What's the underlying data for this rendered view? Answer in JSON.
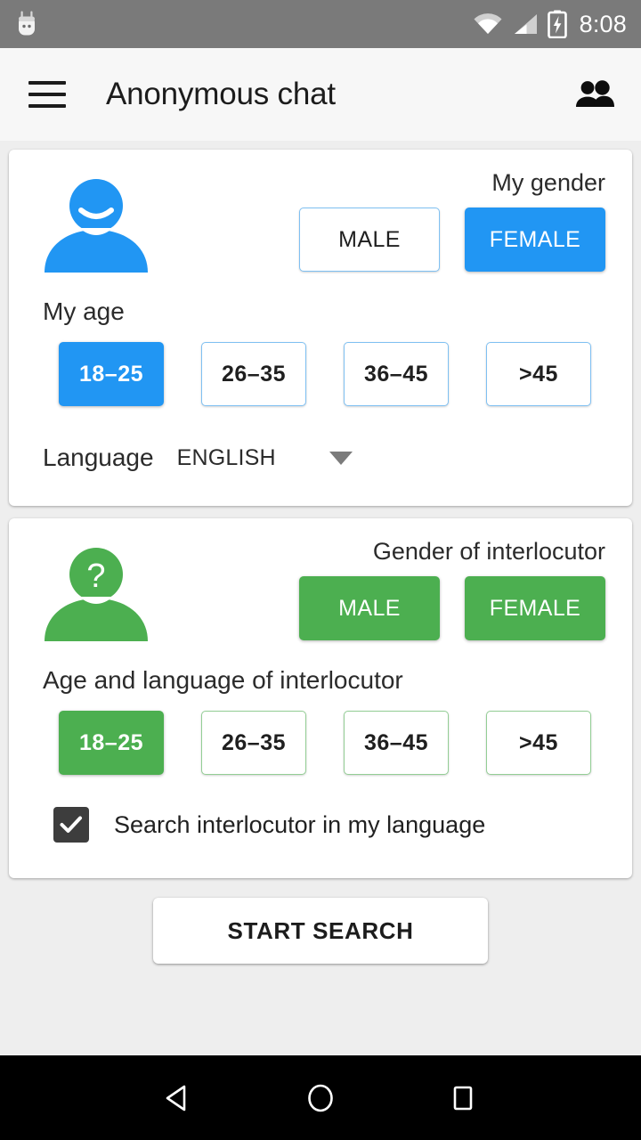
{
  "status_bar": {
    "mascot_icon": "android-mascot-icon",
    "wifi_icon": "wifi-icon",
    "signal_icon": "cell-signal-icon",
    "battery_icon": "battery-charging-icon",
    "time": "8:08"
  },
  "toolbar": {
    "menu_icon": "hamburger-menu-icon",
    "title": "Anonymous chat",
    "action_icon": "people-group-icon"
  },
  "my_profile_card": {
    "avatar_icon": "smiling-person-avatar-icon",
    "avatar_color": "#2196F3",
    "gender_caption": "My gender",
    "gender_options": [
      {
        "label": "MALE",
        "selected": false
      },
      {
        "label": "FEMALE",
        "selected": true
      }
    ],
    "age_label": "My age",
    "age_options": [
      {
        "label": "18–25",
        "selected": true
      },
      {
        "label": "26–35",
        "selected": false
      },
      {
        "label": "36–45",
        "selected": false
      },
      {
        "label": ">45",
        "selected": false
      }
    ],
    "language_label": "Language",
    "language_value": "ENGLISH",
    "dropdown_icon": "chevron-down-icon"
  },
  "interlocutor_card": {
    "avatar_icon": "question-mark-person-avatar-icon",
    "avatar_color": "#4CAF50",
    "gender_caption": "Gender of interlocutor",
    "gender_options": [
      {
        "label": "MALE",
        "selected": true
      },
      {
        "label": "FEMALE",
        "selected": true
      }
    ],
    "age_label": "Age and language of interlocutor",
    "age_options": [
      {
        "label": "18–25",
        "selected": true
      },
      {
        "label": "26–35",
        "selected": false
      },
      {
        "label": "36–45",
        "selected": false
      },
      {
        "label": ">45",
        "selected": false
      }
    ],
    "checkbox": {
      "label": "Search interlocutor in my language",
      "checked": true,
      "icon": "checkmark-icon"
    }
  },
  "start_search": {
    "label": "START SEARCH"
  },
  "nav_bar": {
    "back_icon": "nav-back-triangle-icon",
    "home_icon": "nav-home-circle-icon",
    "recents_icon": "nav-recents-square-icon"
  },
  "colors": {
    "accent_blue": "#2196F3",
    "accent_green": "#4CAF50",
    "page_background": "#EEEEEE",
    "toolbar_background": "#F7F7F7",
    "status_bar_background": "#7A7A7A",
    "checkbox_fill": "#3D3D3D"
  }
}
